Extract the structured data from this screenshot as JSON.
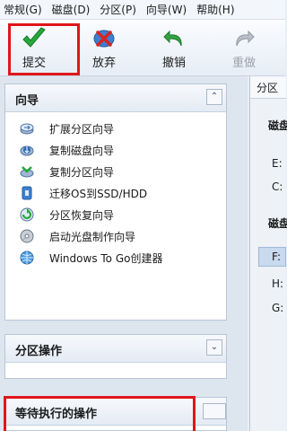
{
  "menu": [
    "常规(G)",
    "磁盘(D)",
    "分区(P)",
    "向导(W)",
    "帮助(H)"
  ],
  "toolbar": {
    "commit": "提交",
    "discard": "放弃",
    "undo": "撤销",
    "redo": "重做"
  },
  "panels": {
    "wizard": {
      "title": "向导",
      "items": [
        {
          "label": "扩展分区向导",
          "icon": "extend-partition-icon"
        },
        {
          "label": "复制磁盘向导",
          "icon": "copy-disk-icon"
        },
        {
          "label": "复制分区向导",
          "icon": "copy-partition-icon"
        },
        {
          "label": "迁移OS到SSD/HDD",
          "icon": "migrate-os-icon"
        },
        {
          "label": "分区恢复向导",
          "icon": "partition-recovery-icon"
        },
        {
          "label": "启动光盘制作向导",
          "icon": "boot-disc-icon"
        },
        {
          "label": "Windows To Go创建器",
          "icon": "windows-to-go-icon"
        }
      ]
    },
    "partition_ops": {
      "title": "分区操作"
    },
    "pending_ops": {
      "title": "等待执行的操作"
    }
  },
  "right": {
    "tab": "分区",
    "disk1": "磁盘",
    "e": "E:",
    "c": "C:",
    "disk2": "磁盘",
    "f": "F:",
    "h": "H:",
    "g": "G:"
  },
  "colors": {
    "highlight": "#e0161b",
    "accent": "#2f6db5"
  }
}
